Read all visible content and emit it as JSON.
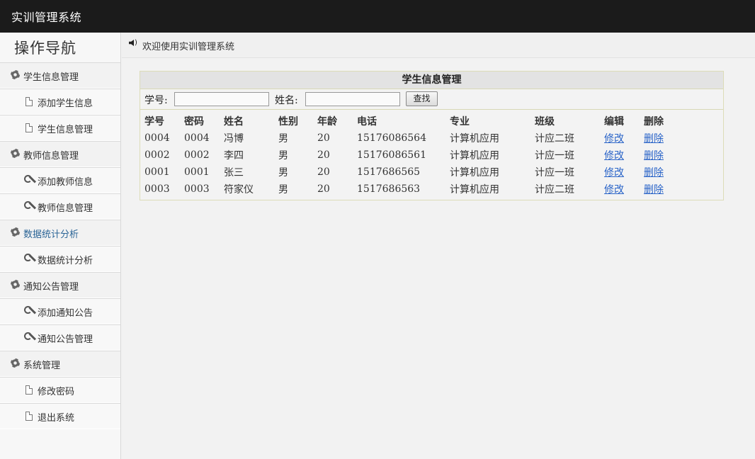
{
  "app": {
    "title": "实训管理系统"
  },
  "sidebar": {
    "title": "操作导航",
    "rows": [
      {
        "type": "group",
        "label": "学生信息管理",
        "icon": "gear-icon"
      },
      {
        "type": "item",
        "label": "添加学生信息",
        "icon": "document-icon"
      },
      {
        "type": "item",
        "label": "学生信息管理",
        "icon": "document-icon"
      },
      {
        "type": "group",
        "label": "教师信息管理",
        "icon": "gear-icon"
      },
      {
        "type": "item",
        "label": "添加教师信息",
        "icon": "wrench-icon"
      },
      {
        "type": "item",
        "label": "教师信息管理",
        "icon": "wrench-icon"
      },
      {
        "type": "group",
        "label": "数据统计分析",
        "icon": "gear-icon",
        "active": true
      },
      {
        "type": "item",
        "label": "数据统计分析",
        "icon": "wrench-icon"
      },
      {
        "type": "group",
        "label": "通知公告管理",
        "icon": "gear-icon"
      },
      {
        "type": "item",
        "label": "添加通知公告",
        "icon": "wrench-icon"
      },
      {
        "type": "item",
        "label": "通知公告管理",
        "icon": "wrench-icon"
      },
      {
        "type": "group",
        "label": "系统管理",
        "icon": "gear-icon"
      },
      {
        "type": "item",
        "label": "修改密码",
        "icon": "document-icon"
      },
      {
        "type": "item",
        "label": "退出系统",
        "icon": "document-icon"
      }
    ]
  },
  "welcome": {
    "text": "欢迎使用实训管理系统",
    "icon": "speaker-icon"
  },
  "panel": {
    "title": "学生信息管理",
    "search": {
      "id_label": "学号:",
      "id_value": "",
      "name_label": "姓名:",
      "name_value": "",
      "button_label": "查找"
    },
    "table": {
      "headers": [
        "学号",
        "密码",
        "姓名",
        "性别",
        "年龄",
        "电话",
        "专业",
        "班级",
        "编辑",
        "删除"
      ],
      "rows": [
        [
          "0004",
          "0004",
          "冯博",
          "男",
          "20",
          "15176086564",
          "计算机应用",
          "计应二班",
          "修改",
          "删除"
        ],
        [
          "0002",
          "0002",
          "李四",
          "男",
          "20",
          "15176086561",
          "计算机应用",
          "计应一班",
          "修改",
          "删除"
        ],
        [
          "0001",
          "0001",
          "张三",
          "男",
          "20",
          "1517686565",
          "计算机应用",
          "计应一班",
          "修改",
          "删除"
        ],
        [
          "0003",
          "0003",
          "符家仪",
          "男",
          "20",
          "1517686563",
          "计算机应用",
          "计应二班",
          "修改",
          "删除"
        ]
      ]
    }
  },
  "colors": {
    "topbar": "#1b1b1b",
    "link": "#2a64c8",
    "active_nav": "#2a6496"
  }
}
